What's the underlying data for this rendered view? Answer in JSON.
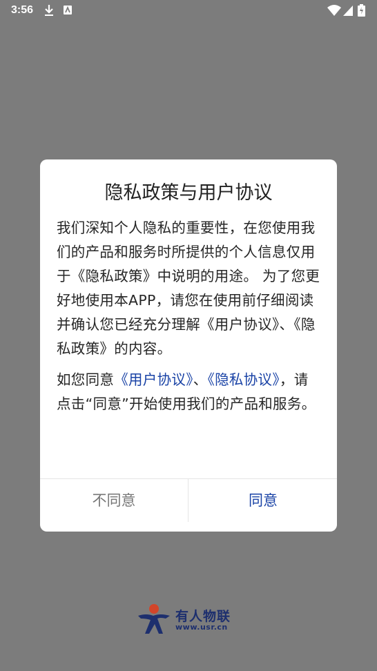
{
  "status_bar": {
    "time": "3:56"
  },
  "dialog": {
    "title": "隐私政策与用户协议",
    "paragraph1": "我们深知个人隐私的重要性，在您使用我们的产品和服务时所提供的个人信息仅用于《隐私政策》中说明的用途。 为了您更好地使用本APP，请您在使用前仔细阅读并确认您已经充分理解《用户协议》、《隐私政策》的内容。",
    "paragraph2": {
      "prefix": "如您同意",
      "user_agreement_link": "《用户协议》",
      "separator": "、",
      "privacy_link": "《隐私协议》",
      "suffix": "，请点击“同意”开始使用我们的产品和服务。"
    },
    "decline_label": "不同意",
    "agree_label": "同意"
  },
  "brand": {
    "name": "有人物联",
    "url": "www.usr.cn"
  },
  "colors": {
    "overlay": "#7c7c7c",
    "link": "#1a43a6",
    "brand": "#1d2f6e",
    "brand_accent": "#d2452a"
  }
}
